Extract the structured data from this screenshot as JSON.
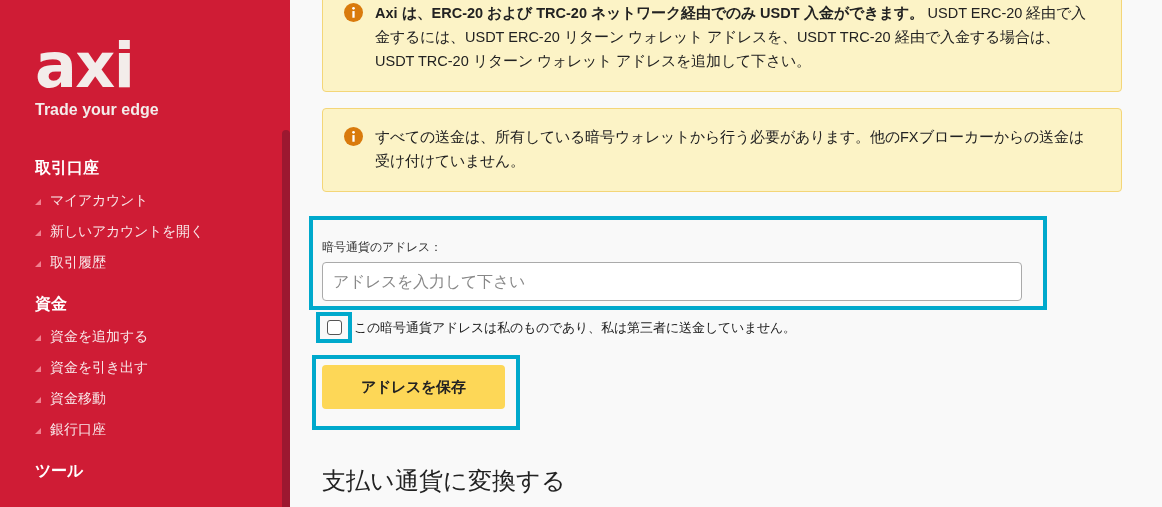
{
  "sidebar": {
    "logo": "axi",
    "tagline": "Trade your edge",
    "sections": [
      {
        "title": "取引口座",
        "items": [
          "マイアカウント",
          "新しいアカウントを開く",
          "取引履歴"
        ]
      },
      {
        "title": "資金",
        "items": [
          "資金を追加する",
          "資金を引き出す",
          "資金移動",
          "銀行口座"
        ]
      },
      {
        "title": "ツール"
      }
    ]
  },
  "notices": [
    {
      "text": "**Axi は、ERC-20 および TRC-20 ネットワーク経由でのみ USDT 入金ができます。** USDT ERC-20 経由で入金するには、USDT ERC-20 リターン ウォレット アドレスを、USDT TRC-20 経由で入金する場合は、USDT TRC-20 リターン ウォレット アドレスを追加して下さい。"
    },
    {
      "text": "すべての送金は、所有している暗号ウォレットから行う必要があります。他のFXブローカーからの送金は受け付けていません。"
    }
  ],
  "form": {
    "label": "暗号通貨のアドレス：",
    "placeholder": "アドレスを入力して下さい",
    "checkbox": {
      "label": "この暗号通貨アドレスは私のものであり、私は第三者に送金していません。",
      "checked": false
    },
    "button": "アドレスを保存"
  },
  "heading": "支払い通貨に変換する"
}
